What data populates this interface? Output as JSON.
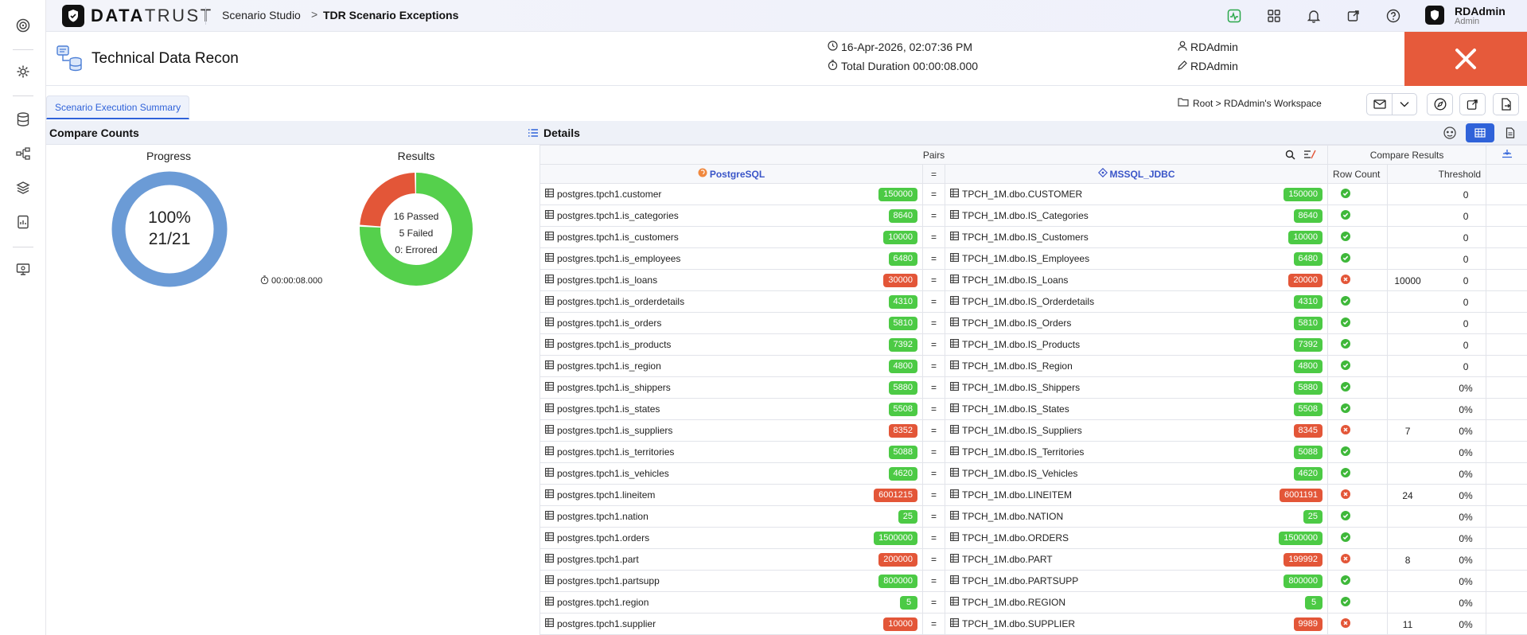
{
  "rail": {
    "icons": [
      "target-icon",
      "gear-icon",
      "database-icon",
      "share-nodes-icon",
      "layers-icon",
      "report-icon",
      "monitor-settings-icon"
    ]
  },
  "topbar": {
    "brand_bold": "DATA",
    "brand_thin": "TRUST",
    "crumb_root": "Scenario Studio",
    "crumb_sep": ">",
    "crumb_current": "TDR Scenario Exceptions",
    "user_name": "RDAdmin",
    "user_role": "Admin"
  },
  "header": {
    "title": "Technical Data Recon",
    "timestamp": "16-Apr-2026, 02:07:36 PM",
    "duration": "Total Duration 00:00:08.000",
    "owner": "RDAdmin",
    "editor": "RDAdmin"
  },
  "tabs": {
    "active": "Scenario Execution Summary"
  },
  "workspace": {
    "path": "Root > RDAdmin's Workspace"
  },
  "compare_counts": {
    "title": "Compare Counts",
    "progress_label": "Progress",
    "progress_pct": "100%",
    "progress_frac": "21/21",
    "progress_value": 1.0,
    "elapsed": "00:00:08.000",
    "results_label": "Results",
    "passed_text": "16 Passed",
    "failed_text": "5 Failed",
    "errored_text": "0: Errored",
    "passed": 16,
    "failed": 5,
    "errored": 0,
    "colors": {
      "progress": "#6b9bd6",
      "passed": "#55d04c",
      "failed": "#e35638"
    }
  },
  "details": {
    "title": "Details",
    "pairs_label": "Pairs",
    "compare_results_label": "Compare Results",
    "source_name": "PostgreSQL",
    "target_name": "MSSQL_JDBC",
    "eq_header": "=",
    "row_count_label": "Row Count",
    "threshold_label": "Threshold",
    "rows": [
      {
        "src": "postgres.tpch1.customer",
        "src_count": "150000",
        "tgt": "TPCH_1M.dbo.CUSTOMER",
        "tgt_count": "150000",
        "ok": true,
        "row_count": "",
        "threshold": "0"
      },
      {
        "src": "postgres.tpch1.is_categories",
        "src_count": "8640",
        "tgt": "TPCH_1M.dbo.IS_Categories",
        "tgt_count": "8640",
        "ok": true,
        "row_count": "",
        "threshold": "0"
      },
      {
        "src": "postgres.tpch1.is_customers",
        "src_count": "10000",
        "tgt": "TPCH_1M.dbo.IS_Customers",
        "tgt_count": "10000",
        "ok": true,
        "row_count": "",
        "threshold": "0"
      },
      {
        "src": "postgres.tpch1.is_employees",
        "src_count": "6480",
        "tgt": "TPCH_1M.dbo.IS_Employees",
        "tgt_count": "6480",
        "ok": true,
        "row_count": "",
        "threshold": "0"
      },
      {
        "src": "postgres.tpch1.is_loans",
        "src_count": "30000",
        "tgt": "TPCH_1M.dbo.IS_Loans",
        "tgt_count": "20000",
        "ok": false,
        "row_count": "10000",
        "threshold": "0"
      },
      {
        "src": "postgres.tpch1.is_orderdetails",
        "src_count": "4310",
        "tgt": "TPCH_1M.dbo.IS_Orderdetails",
        "tgt_count": "4310",
        "ok": true,
        "row_count": "",
        "threshold": "0"
      },
      {
        "src": "postgres.tpch1.is_orders",
        "src_count": "5810",
        "tgt": "TPCH_1M.dbo.IS_Orders",
        "tgt_count": "5810",
        "ok": true,
        "row_count": "",
        "threshold": "0"
      },
      {
        "src": "postgres.tpch1.is_products",
        "src_count": "7392",
        "tgt": "TPCH_1M.dbo.IS_Products",
        "tgt_count": "7392",
        "ok": true,
        "row_count": "",
        "threshold": "0"
      },
      {
        "src": "postgres.tpch1.is_region",
        "src_count": "4800",
        "tgt": "TPCH_1M.dbo.IS_Region",
        "tgt_count": "4800",
        "ok": true,
        "row_count": "",
        "threshold": "0"
      },
      {
        "src": "postgres.tpch1.is_shippers",
        "src_count": "5880",
        "tgt": "TPCH_1M.dbo.IS_Shippers",
        "tgt_count": "5880",
        "ok": true,
        "row_count": "",
        "threshold": "0%"
      },
      {
        "src": "postgres.tpch1.is_states",
        "src_count": "5508",
        "tgt": "TPCH_1M.dbo.IS_States",
        "tgt_count": "5508",
        "ok": true,
        "row_count": "",
        "threshold": "0%"
      },
      {
        "src": "postgres.tpch1.is_suppliers",
        "src_count": "8352",
        "tgt": "TPCH_1M.dbo.IS_Suppliers",
        "tgt_count": "8345",
        "ok": false,
        "row_count": "7",
        "threshold": "0%"
      },
      {
        "src": "postgres.tpch1.is_territories",
        "src_count": "5088",
        "tgt": "TPCH_1M.dbo.IS_Territories",
        "tgt_count": "5088",
        "ok": true,
        "row_count": "",
        "threshold": "0%"
      },
      {
        "src": "postgres.tpch1.is_vehicles",
        "src_count": "4620",
        "tgt": "TPCH_1M.dbo.IS_Vehicles",
        "tgt_count": "4620",
        "ok": true,
        "row_count": "",
        "threshold": "0%"
      },
      {
        "src": "postgres.tpch1.lineitem",
        "src_count": "6001215",
        "tgt": "TPCH_1M.dbo.LINEITEM",
        "tgt_count": "6001191",
        "ok": false,
        "row_count": "24",
        "threshold": "0%"
      },
      {
        "src": "postgres.tpch1.nation",
        "src_count": "25",
        "tgt": "TPCH_1M.dbo.NATION",
        "tgt_count": "25",
        "ok": true,
        "row_count": "",
        "threshold": "0%"
      },
      {
        "src": "postgres.tpch1.orders",
        "src_count": "1500000",
        "tgt": "TPCH_1M.dbo.ORDERS",
        "tgt_count": "1500000",
        "ok": true,
        "row_count": "",
        "threshold": "0%"
      },
      {
        "src": "postgres.tpch1.part",
        "src_count": "200000",
        "tgt": "TPCH_1M.dbo.PART",
        "tgt_count": "199992",
        "ok": false,
        "row_count": "8",
        "threshold": "0%"
      },
      {
        "src": "postgres.tpch1.partsupp",
        "src_count": "800000",
        "tgt": "TPCH_1M.dbo.PARTSUPP",
        "tgt_count": "800000",
        "ok": true,
        "row_count": "",
        "threshold": "0%"
      },
      {
        "src": "postgres.tpch1.region",
        "src_count": "5",
        "tgt": "TPCH_1M.dbo.REGION",
        "tgt_count": "5",
        "ok": true,
        "row_count": "",
        "threshold": "0%"
      },
      {
        "src": "postgres.tpch1.supplier",
        "src_count": "10000",
        "tgt": "TPCH_1M.dbo.SUPPLIER",
        "tgt_count": "9989",
        "ok": false,
        "row_count": "11",
        "threshold": "0%"
      }
    ]
  }
}
